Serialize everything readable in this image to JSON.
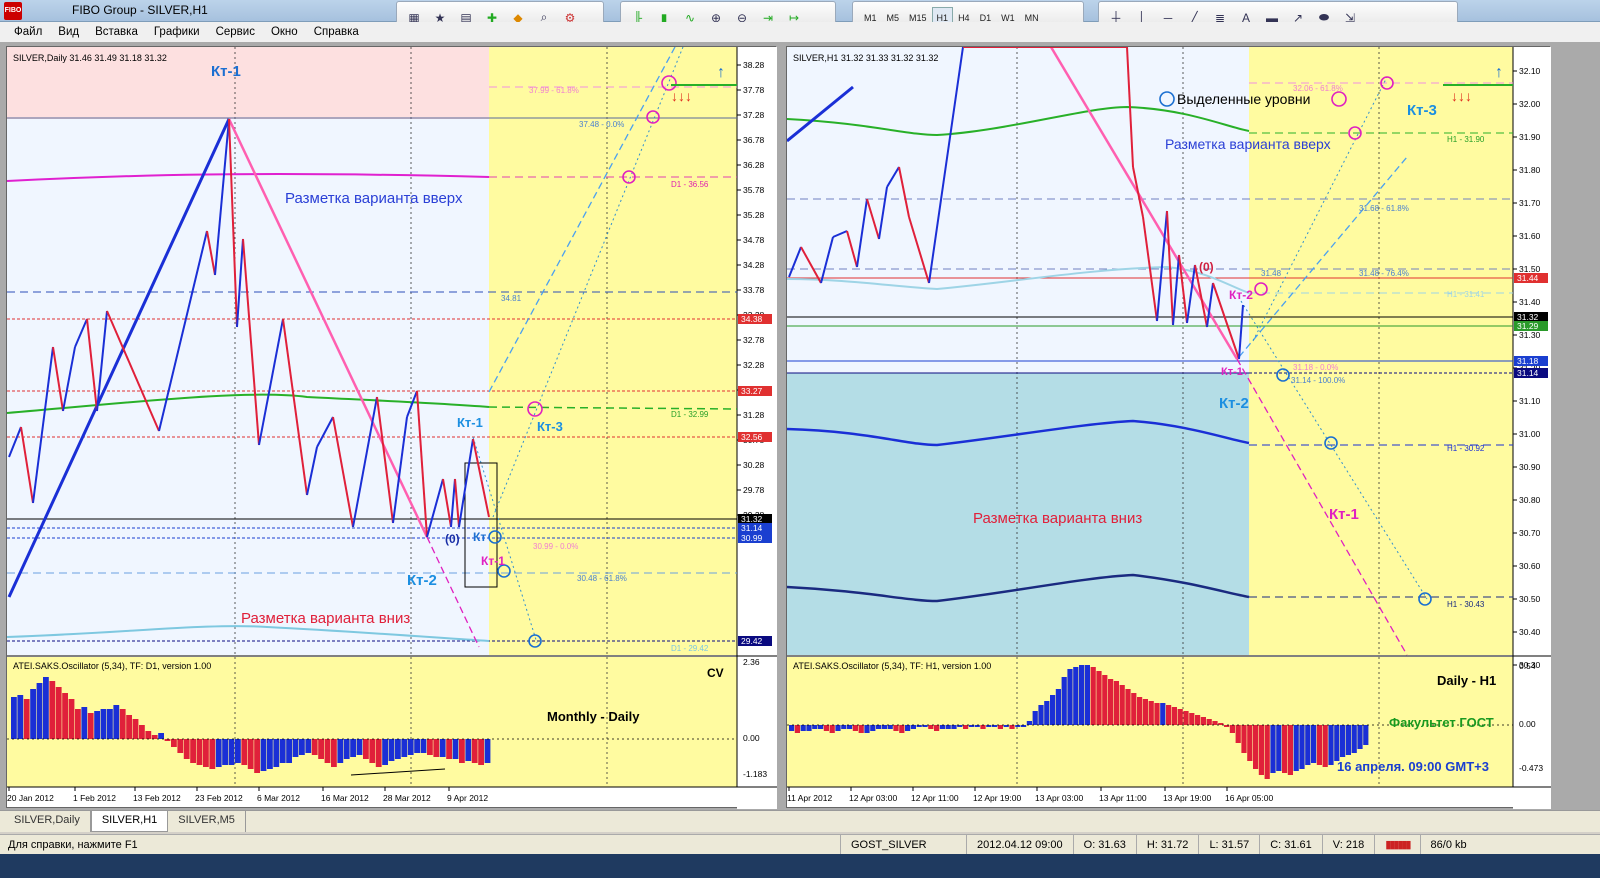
{
  "window": {
    "title": "FIBO Group - SILVER,H1",
    "logo": "FIBO"
  },
  "menu": [
    "Файл",
    "Вид",
    "Вставка",
    "Графики",
    "Сервис",
    "Окно",
    "Справка"
  ],
  "timeframes": [
    "M1",
    "M5",
    "M15",
    "H1",
    "H4",
    "D1",
    "W1",
    "MN"
  ],
  "active_timeframe": "H1",
  "icons": {
    "toolbar1": [
      "market-watch-icon",
      "favorites-icon",
      "navigator-icon",
      "new-order-icon",
      "alert-icon",
      "zoom-magnifier-icon",
      "settings-icon"
    ],
    "toolbar2": [
      "bar-chart-icon",
      "candle-chart-icon",
      "line-chart-icon",
      "zoom-in-icon",
      "zoom-out-icon",
      "chart-shift-icon",
      "autoscroll-icon"
    ],
    "toolbar4": [
      "crosshair-icon",
      "vertical-line-icon",
      "horizontal-line-icon",
      "trendline-icon",
      "fibo-icon",
      "text-icon",
      "rectangle-icon",
      "arrow-icon",
      "ellipse-icon",
      "more-icon"
    ]
  },
  "left_chart": {
    "header": "SILVER,Daily  31.46 31.49 31.18 31.32",
    "price_labels": [
      "38.28",
      "37.78",
      "37.28",
      "36.78",
      "36.28",
      "35.78",
      "35.28",
      "34.78",
      "34.28",
      "33.78",
      "33.28",
      "32.78",
      "32.28",
      "31.78",
      "31.28",
      "30.78",
      "30.28",
      "29.78",
      "29.28"
    ],
    "highlight_labels": [
      {
        "text": "34.38",
        "bg": "#e03030"
      },
      {
        "text": "33.27",
        "bg": "#e03030"
      },
      {
        "text": "32.56",
        "bg": "#e03030"
      },
      {
        "text": "31.32",
        "bg": "#000000"
      },
      {
        "text": "31.14",
        "bg": "#1a3fd0"
      },
      {
        "text": "30.99",
        "bg": "#1a3fd0"
      },
      {
        "text": "29.42",
        "bg": "#0a0a80"
      }
    ],
    "time_labels": [
      "20 Jan 2012",
      "1 Feb 2012",
      "13 Feb 2012",
      "23 Feb 2012",
      "6 Mar 2012",
      "16 Mar 2012",
      "28 Mar 2012",
      "9 Apr 2012"
    ],
    "annotations": {
      "kt1_top": "Кт-1",
      "up_variant": "Разметка варианта вверх",
      "down_variant": "Разметка варианта вниз",
      "kt1_mid": "Кт-1",
      "kt3": "Кт-3",
      "kt2": "Кт-2",
      "kt1_bottom": "Кт-1",
      "kt_blue": "Кт",
      "zero": "(0)",
      "fib_3799": "37.99 - 61.8%",
      "fib_3748": "37.48 - 0.0%",
      "d1_3656": "D1 - 36.56",
      "lvl_3481": "34.81",
      "d1_3299": "D1 - 32.99",
      "fib_3099": "30.99 - 0.0%",
      "fib_3048": "30.48 - 61.8%",
      "d1_2942": "D1 - 29.42"
    },
    "oscillator": {
      "header": "ATEI.SAKS.Oscillator (5,34), TF: D1, version 1.00",
      "labels": [
        "2.36",
        "0.00",
        "-1.183"
      ],
      "corner_text": "CV",
      "caption": "Monthly - Daily"
    }
  },
  "right_chart": {
    "header": "SILVER,H1  31.32 31.33 31.32 31.32",
    "price_labels": [
      "32.10",
      "32.00",
      "31.90",
      "31.80",
      "31.70",
      "31.60",
      "31.50",
      "31.40",
      "31.30",
      "31.20",
      "31.10",
      "31.00",
      "30.90",
      "30.80",
      "30.70",
      "30.60",
      "30.50",
      "30.40",
      "30.30"
    ],
    "highlight_labels": [
      {
        "text": "31.44",
        "bg": "#e03030"
      },
      {
        "text": "31.32",
        "bg": "#000000"
      },
      {
        "text": "31.29",
        "bg": "#2a9a2a"
      },
      {
        "text": "31.18",
        "bg": "#1a3fd0"
      },
      {
        "text": "31.14",
        "bg": "#0a0a80"
      }
    ],
    "time_labels": [
      "11 Apr 2012",
      "12 Apr 03:00",
      "12 Apr 11:00",
      "12 Apr 19:00",
      "13 Apr 03:00",
      "13 Apr 11:00",
      "13 Apr 19:00",
      "16 Apr 05:00"
    ],
    "annotations": {
      "legend": "Выделенные уровни",
      "up_variant": "Разметка варианта вверх",
      "down_variant": "Разметка варианта вниз",
      "kt3": "Кт-3",
      "kt2_right": "Кт-2",
      "kt2_blue": "Кт-2",
      "kt1_bottom": "Кт-1",
      "kt1_label": "Кт-1",
      "zero": "(0)",
      "fib_3206": "32.06 - 61.8%",
      "h1_3190": "H1 - 31.90",
      "fib_3168": "31.68 - 61.8%",
      "lvl_3148": "31.48",
      "fib_3148": "31.48 - 76.4%",
      "h1_3141": "H1 - 31.41",
      "fib_3118": "31.18 - 0.0%",
      "fib_3114": "31.14 - 100.0%",
      "h1_3092": "H1 - 30.92",
      "h1_3043": "H1 - 30.43"
    },
    "oscillator": {
      "header": "ATEI.SAKS.Oscillator (5,34), TF: H1, version 1.00",
      "labels": [
        "0.54",
        "0.00",
        "-0.473"
      ],
      "caption1": "Daily - H1",
      "caption2": "Факультет ГОСТ",
      "caption3": "16 апреля. 09:00 GMT+3"
    }
  },
  "tabs": [
    "SILVER,Daily",
    "SILVER,H1",
    "SILVER,M5"
  ],
  "active_tab": "SILVER,H1",
  "status": {
    "help": "Для справки, нажмите F1",
    "profile": "GOST_SILVER",
    "datetime": "2012.04.12 09:00",
    "open": "O: 31.63",
    "high": "H: 31.72",
    "low": "L: 31.57",
    "close": "C: 31.61",
    "volume": "V: 218",
    "traffic": "86/0 kb"
  },
  "colors": {
    "chart_bg": "#f0f6ff",
    "future_zone": "#fffba0",
    "up_zone": "#fde0e0",
    "down_zone": "#b4dde6",
    "bull": "#1a2fd6",
    "bear": "#e0203a",
    "annotation_blue": "#1c6fd1",
    "annotation_magenta": "#e020c0"
  }
}
